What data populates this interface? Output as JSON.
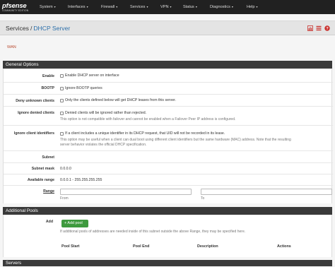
{
  "brand": {
    "logo_main": "pfsense",
    "logo_sub": "COMMUNITY EDITION"
  },
  "menu": [
    {
      "label": "System"
    },
    {
      "label": "Interfaces"
    },
    {
      "label": "Firewall"
    },
    {
      "label": "Services"
    },
    {
      "label": "VPN"
    },
    {
      "label": "Status"
    },
    {
      "label": "Diagnostics"
    },
    {
      "label": "Help"
    }
  ],
  "breadcrumb": {
    "parent": "Services",
    "separator": "/",
    "current": "DHCP Server"
  },
  "header_icons": [
    "chart-icon",
    "list-icon",
    "help-icon"
  ],
  "tab": "WAN",
  "general": {
    "title": "General Options",
    "enable_label": "Enable",
    "enable_text": "Enable DHCP server on interface",
    "bootp_label": "BOOTP",
    "bootp_text": "Ignore BOOTP queries",
    "deny_label": "Deny unknown clients",
    "deny_text": "Only the clients defined below will get DHCP leases from this server.",
    "ignore_denied_label": "Ignore denied clients",
    "ignore_denied_text": "Denied clients will be ignored rather than rejected.",
    "ignore_denied_help": "This option is not compatible with failover and cannot be enabled when a Failover Peer IP address is configured.",
    "ignore_id_label": "Ignore client identifiers",
    "ignore_id_text": "If a client includes a unique identifier in its DHCP request, that UID will not be recorded in its lease.",
    "ignore_id_help1": "This option may be useful when a client can dual boot using different client identifiers but the same hardware (MAC) address. Note that the resulting",
    "ignore_id_help2": "server behavior violates the official DHCP specification.",
    "subnet_label": "Subnet",
    "subnet_value": "",
    "mask_label": "Subnet mask",
    "mask_value": "0.0.0.0",
    "avail_label": "Available range",
    "avail_value": "0.0.0.1 - 255.255.255.255",
    "range_label": "Range",
    "range_from": "",
    "range_to": "",
    "from_label": "From",
    "to_label": "To"
  },
  "pools": {
    "title": "Additional Pools",
    "add_label": "Add",
    "add_button": "Add pool",
    "help": "If additional pools of addresses are needed inside of this subnet outside the above Range, they may be specified here.",
    "columns": [
      "Pool Start",
      "Pool End",
      "Description",
      "Actions"
    ]
  },
  "servers": {
    "title": "Servers"
  },
  "colors": {
    "topbar": "#212121",
    "accent": "#2c6faa",
    "tab": "#b94a2f",
    "panel": "#3a3a3a",
    "add_button": "#3e9a3e"
  }
}
